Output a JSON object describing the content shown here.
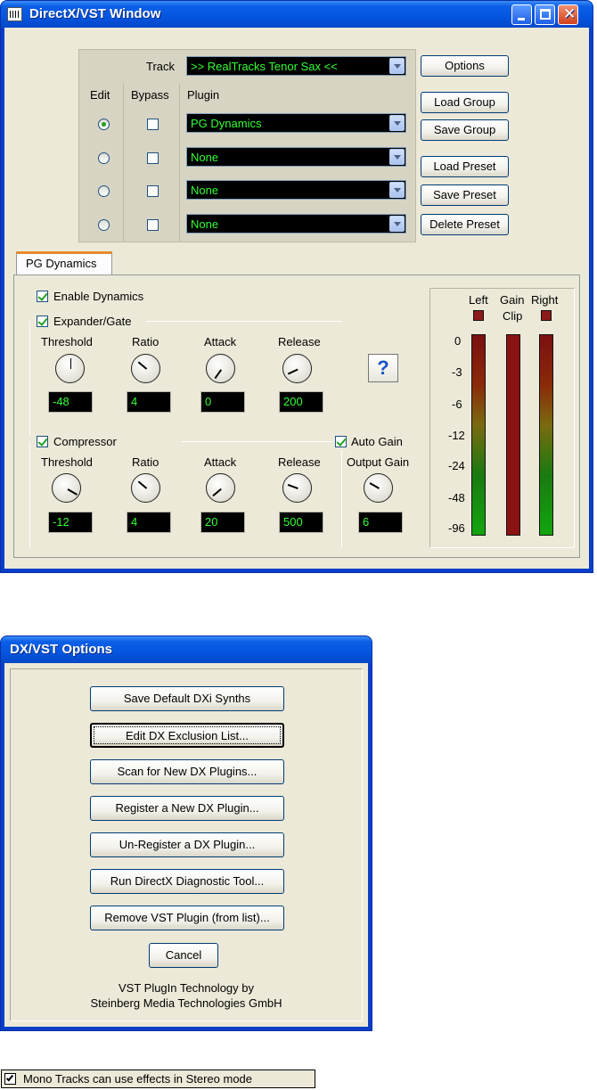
{
  "top_window": {
    "title": "DirectX/VST Window",
    "track_label": "Track",
    "track_value": ">> RealTracks Tenor Sax <<",
    "headers": {
      "edit": "Edit",
      "bypass": "Bypass",
      "plugin": "Plugin"
    },
    "rows": [
      {
        "plugin": "PG Dynamics",
        "edit_selected": true,
        "bypass": false
      },
      {
        "plugin": "None",
        "edit_selected": false,
        "bypass": false
      },
      {
        "plugin": "None",
        "edit_selected": false,
        "bypass": false
      },
      {
        "plugin": "None",
        "edit_selected": false,
        "bypass": false
      }
    ],
    "buttons": {
      "options": "Options",
      "load_group": "Load Group",
      "save_group": "Save Group",
      "load_preset": "Load Preset",
      "save_preset": "Save Preset",
      "delete_preset": "Delete Preset"
    },
    "tab_label": "PG Dynamics",
    "enable_dynamics": {
      "label": "Enable Dynamics",
      "checked": true
    },
    "expander": {
      "label": "Expander/Gate",
      "checked": true,
      "knobs": [
        {
          "label": "Threshold",
          "value": "-48"
        },
        {
          "label": "Ratio",
          "value": "4"
        },
        {
          "label": "Attack",
          "value": "0"
        },
        {
          "label": "Release",
          "value": "200"
        }
      ]
    },
    "compressor": {
      "label": "Compressor",
      "checked": true,
      "knobs": [
        {
          "label": "Threshold",
          "value": "-12"
        },
        {
          "label": "Ratio",
          "value": "4"
        },
        {
          "label": "Attack",
          "value": "20"
        },
        {
          "label": "Release",
          "value": "500"
        }
      ]
    },
    "auto_gain": {
      "label": "Auto Gain",
      "checked": true
    },
    "output_gain": {
      "label": "Output Gain",
      "value": "6"
    },
    "help_symbol": "?",
    "meters": {
      "left": "Left",
      "gain": "Gain",
      "right": "Right",
      "clip": "Clip",
      "scale": [
        "0",
        "-3",
        "-6",
        "-12",
        "-24",
        "-48",
        "-96"
      ]
    }
  },
  "options_window": {
    "title": "DX/VST Options",
    "buttons": [
      "Save Default DXi Synths",
      "Edit DX Exclusion List...",
      "Scan for New DX Plugins...",
      "Register a New DX Plugin...",
      "Un-Register a DX Plugin...",
      "Run DirectX Diagnostic Tool...",
      "Remove VST Plugin (from list)..."
    ],
    "cancel": "Cancel",
    "footer_line1": "VST PlugIn Technology by",
    "footer_line2": "Steinberg Media Technologies GmbH"
  },
  "mono_option": {
    "label": "Mono Tracks can use effects in Stereo mode",
    "checked": true
  }
}
